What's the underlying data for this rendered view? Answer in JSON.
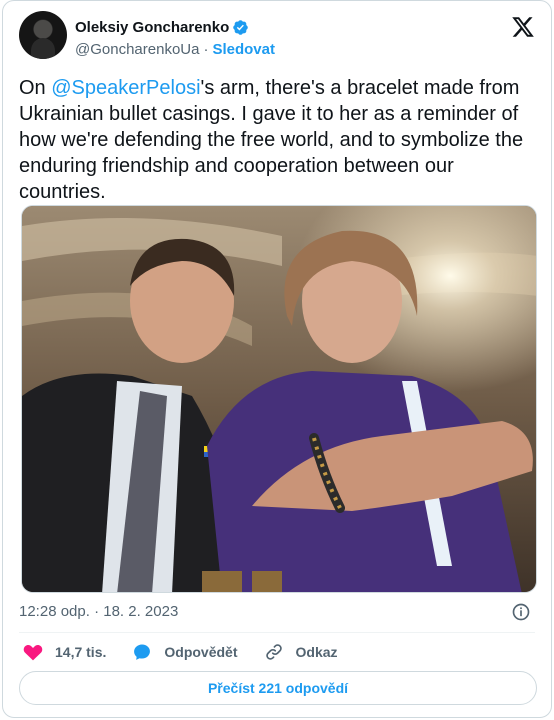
{
  "author": {
    "name": "Oleksiy Goncharenko",
    "handle": "@GoncharenkoUa",
    "follow_label": "Sledovat"
  },
  "tweet": {
    "prefix": "On ",
    "mention": "@SpeakerPelosi",
    "body": "'s arm, there's a bracelet made from Ukrainian bullet casings. I gave it to her as a reminder of how we're defending the free world, and to symbolize the enduring friendship and cooperation between our countries."
  },
  "timestamp": "12:28 odp. · 18. 2. 2023",
  "actions": {
    "like_count": "14,7 tis.",
    "reply_label": "Odpovědět",
    "link_label": "Odkaz"
  },
  "read_replies_label": "Přečíst 221 odpovědí",
  "icons": [
    "verified-icon",
    "x-logo-icon",
    "info-icon",
    "heart-icon",
    "reply-icon",
    "link-icon"
  ],
  "colors": {
    "accent": "#1d9bf0",
    "like": "#f91880",
    "text": "#0f1419",
    "muted": "#536471"
  }
}
